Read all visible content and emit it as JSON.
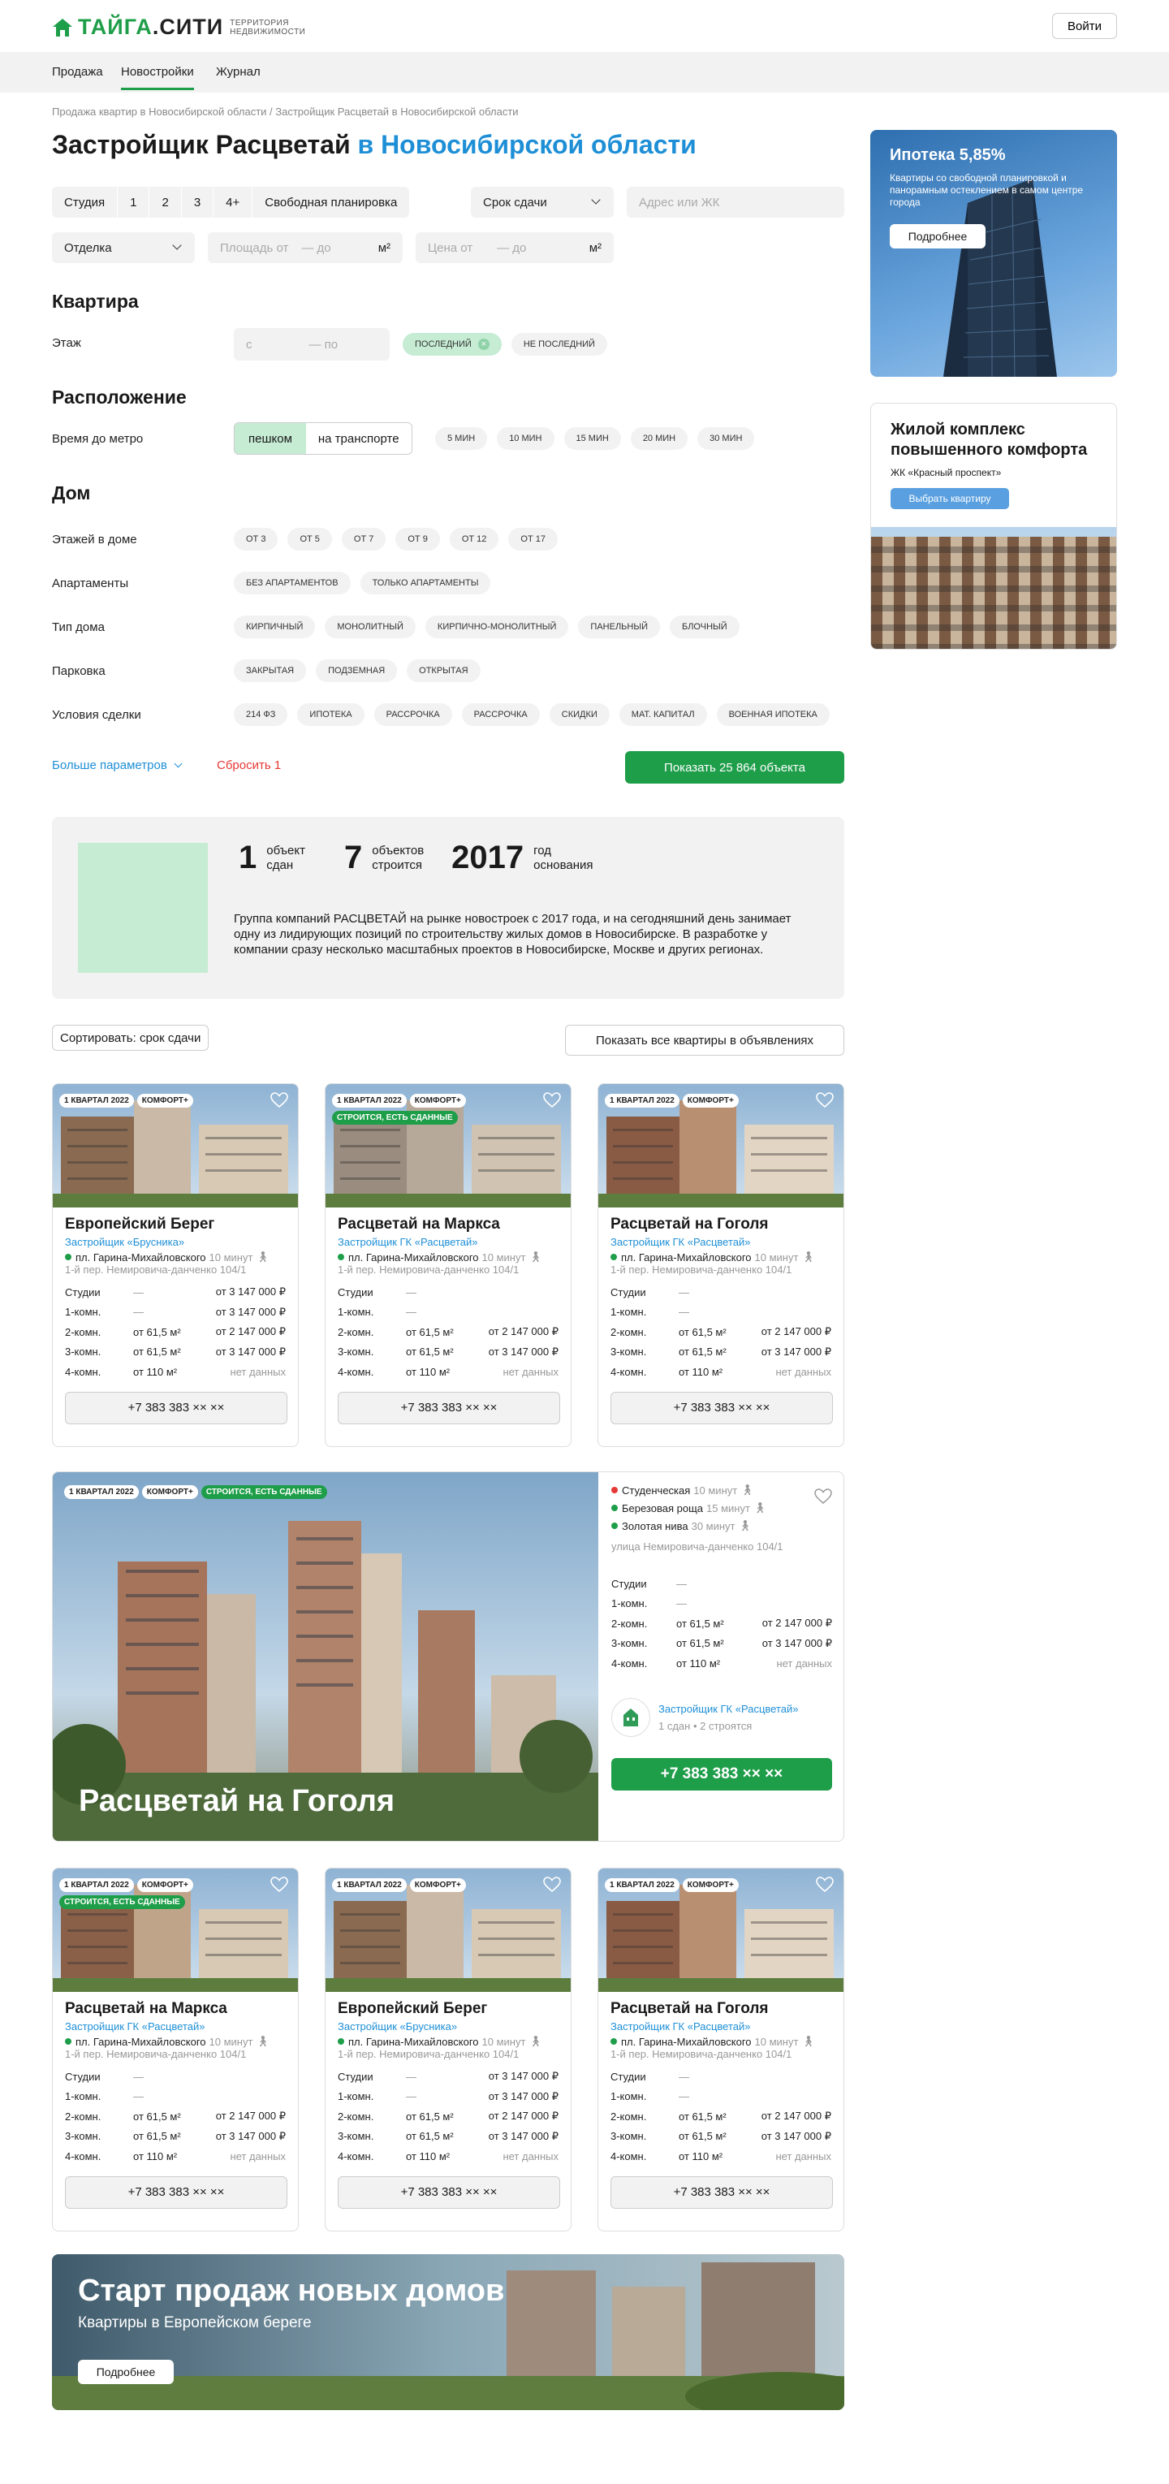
{
  "header": {
    "brand_a": "ТАЙГА",
    "brand_b": ".СИТИ",
    "tagline_1": "ТЕРРИТОРИЯ",
    "tagline_2": "НЕДВИЖИМОСТИ",
    "login": "Войти"
  },
  "nav": [
    "Продажа",
    "Новостройки",
    "Журнал"
  ],
  "breadcrumb": "Продажа квартир в Новосибирской области / Застройщик Расцветай в Новосибирской области",
  "title": {
    "a": "Застройщик Расцветай",
    "b": "в Новосибирской области"
  },
  "filters": {
    "rooms": [
      "Студия",
      "1",
      "2",
      "3",
      "4+",
      "Свободная планировка"
    ],
    "deadline": "Срок сдачи",
    "address_ph": "Адрес или ЖК",
    "finish": "Отделка",
    "area_from": "Площадь от",
    "area_to": "— до",
    "area_unit": "м²",
    "price_from": "Цена от",
    "price_to": "— до",
    "price_unit": "м²"
  },
  "sections": {
    "flat": "Квартира",
    "location": "Расположение",
    "house": "Дом"
  },
  "floor": {
    "label": "Этаж",
    "from": "с",
    "to": "— по",
    "pills": [
      "последний",
      "не последний"
    ]
  },
  "metro": {
    "label": "Время до метро",
    "modes": [
      "пешком",
      "на транспорте"
    ],
    "pills": [
      "5 мин",
      "10 мин",
      "15 мин",
      "20 мин",
      "30 мин"
    ]
  },
  "house_rows": [
    {
      "label": "Этажей в доме",
      "pills": [
        "от 3",
        "от 5",
        "от 7",
        "от 9",
        "от 12",
        "от 17"
      ]
    },
    {
      "label": "Апартаменты",
      "pills": [
        "без апартаментов",
        "только апартаменты"
      ]
    },
    {
      "label": "Тип дома",
      "pills": [
        "кирпичный",
        "монолитный",
        "кирпично-монолитный",
        "панельный",
        "блочный"
      ]
    },
    {
      "label": "Парковка",
      "pills": [
        "закрытая",
        "подземная",
        "открытая"
      ]
    },
    {
      "label": "Условия сделки",
      "pills": [
        "214 ФЗ",
        "ипотека",
        "рассрочка",
        "рассрочка",
        "скидки",
        "мат. капитал",
        "военная ипотека"
      ]
    }
  ],
  "actions": {
    "more": "Больше параметров",
    "reset": "Сбросить 1",
    "show": "Показать 25 864 объекта"
  },
  "stats": [
    {
      "num": "1",
      "l1": "объект",
      "l2": "сдан"
    },
    {
      "num": "7",
      "l1": "объектов",
      "l2": "строится"
    },
    {
      "num": "2017",
      "l1": "год",
      "l2": "основания"
    }
  ],
  "about_text": "Группа компаний РАСЦВЕТАЙ на рынке новостроек с 2017 года, и на сегодняшний день занимает одну из лидирующих позиций по строительству жилых домов в Новосибирске. В разработке у компании сразу несколько масштабных проектов в Новосибирске, Москве и других регионах.",
  "sort": "Сортировать: срок сдачи",
  "show_all": "Показать все квартиры в объявлениях",
  "ads": {
    "mortgage": {
      "title": "Ипотека 5,85%",
      "text": "Квартиры со свободной планировкой и панорамным остеклением в самом центре города",
      "btn": "Подробнее"
    },
    "complex": {
      "title": "Жилой комплекс повышенного комфорта",
      "sub": "ЖК «Красный проспект»",
      "btn": "Выбрать квартиру"
    }
  },
  "cards": [
    {
      "badges": [
        "1 КВАРТАЛ 2022",
        "КОМФОРТ+"
      ],
      "green": "",
      "title": "Европейский Берег",
      "dev": "Застройщик «Брусника»",
      "metro": "пл. Гарина-Михайловского",
      "mins": "10 минут",
      "addr": "1-й пер. Немировича-данченко 104/1",
      "rows": [
        [
          "Студии",
          "—",
          "от 3 147 000 ₽"
        ],
        [
          "1-комн.",
          "—",
          "от 3 147 000 ₽"
        ],
        [
          "2-комн.",
          "от 61,5 м²",
          "от 2 147 000 ₽"
        ],
        [
          "3-комн.",
          "от 61,5 м²",
          "от 3 147 000 ₽"
        ],
        [
          "4-комн.",
          "от 110 м²",
          "нет данных"
        ]
      ],
      "phone": "+7 383 383 ×× ××"
    },
    {
      "badges": [
        "1 КВАРТАЛ 2022",
        "КОМФОРТ+"
      ],
      "green": "СТРОИТСЯ, ЕСТЬ СДАННЫЕ",
      "title": "Расцветай на Марксa",
      "dev": "Застройщик ГК «Расцветай»",
      "metro": "пл. Гарина-Михайловского",
      "mins": "10 минут",
      "addr": "1-й пер. Немировича-данченко 104/1",
      "rows": [
        [
          "Студии",
          "—",
          ""
        ],
        [
          "1-комн.",
          "—",
          ""
        ],
        [
          "2-комн.",
          "от 61,5 м²",
          "от 2 147 000 ₽"
        ],
        [
          "3-комн.",
          "от 61,5 м²",
          "от 3 147 000 ₽"
        ],
        [
          "4-комн.",
          "от 110 м²",
          "нет данных"
        ]
      ],
      "phone": "+7 383 383 ×× ××"
    },
    {
      "badges": [
        "1 КВАРТАЛ 2022",
        "КОМФОРТ+"
      ],
      "green": "",
      "title": "Расцветай на Гоголя",
      "dev": "Застройщик ГК «Расцветай»",
      "metro": "пл. Гарина-Михайловского",
      "mins": "10 минут",
      "addr": "1-й пер. Немировича-данченко 104/1",
      "rows": [
        [
          "Студии",
          "—",
          ""
        ],
        [
          "1-комн.",
          "—",
          ""
        ],
        [
          "2-комн.",
          "от 61,5 м²",
          "от 2 147 000 ₽"
        ],
        [
          "3-комн.",
          "от 61,5 м²",
          "от 3 147 000 ₽"
        ],
        [
          "4-комн.",
          "от 110 м²",
          "нет данных"
        ]
      ],
      "phone": "+7 383 383 ×× ××"
    },
    {
      "badges": [
        "1 КВАРТАЛ 2022",
        "КОМФОРТ+"
      ],
      "green": "СТРОИТСЯ, ЕСТЬ СДАННЫЕ",
      "title": "Расцветай на Марксa",
      "dev": "Застройщик ГК «Расцветай»",
      "metro": "пл. Гарина-Михайловского",
      "mins": "10 минут",
      "addr": "1-й пер. Немировича-данченко 104/1",
      "rows": [
        [
          "Студии",
          "—",
          ""
        ],
        [
          "1-комн.",
          "—",
          ""
        ],
        [
          "2-комн.",
          "от 61,5 м²",
          "от 2 147 000 ₽"
        ],
        [
          "3-комн.",
          "от 61,5 м²",
          "от 3 147 000 ₽"
        ],
        [
          "4-комн.",
          "от 110 м²",
          "нет данных"
        ]
      ],
      "phone": "+7 383 383 ×× ××"
    },
    {
      "badges": [
        "1 КВАРТАЛ 2022",
        "КОМФОРТ+"
      ],
      "green": "",
      "title": "Европейский Берег",
      "dev": "Застройщик «Брусника»",
      "metro": "пл. Гарина-Михайловского",
      "mins": "10 минут",
      "addr": "1-й пер. Немировича-данченко 104/1",
      "rows": [
        [
          "Студии",
          "—",
          "от 3 147 000 ₽"
        ],
        [
          "1-комн.",
          "—",
          "от 3 147 000 ₽"
        ],
        [
          "2-комн.",
          "от 61,5 м²",
          "от 2 147 000 ₽"
        ],
        [
          "3-комн.",
          "от 61,5 м²",
          "от 3 147 000 ₽"
        ],
        [
          "4-комн.",
          "от 110 м²",
          "нет данных"
        ]
      ],
      "phone": "+7 383 383 ×× ××"
    },
    {
      "badges": [
        "1 КВАРТАЛ 2022",
        "КОМФОРТ+"
      ],
      "green": "",
      "title": "Расцветай на Гоголя",
      "dev": "Застройщик ГК «Расцветай»",
      "metro": "пл. Гарина-Михайловского",
      "mins": "10 минут",
      "addr": "1-й пер. Немировича-данченко 104/1",
      "rows": [
        [
          "Студии",
          "—",
          ""
        ],
        [
          "1-комн.",
          "—",
          ""
        ],
        [
          "2-комн.",
          "от 61,5 м²",
          "от 2 147 000 ₽"
        ],
        [
          "3-комн.",
          "от 61,5 м²",
          "от 3 147 000 ₽"
        ],
        [
          "4-комн.",
          "от 110 м²",
          "нет данных"
        ]
      ],
      "phone": "+7 383 383 ×× ××"
    }
  ],
  "big": {
    "badges": [
      "1 КВАРТАЛ 2022",
      "КОМФОРТ+"
    ],
    "green": "СТРОИТСЯ, ЕСТЬ СДАННЫЕ",
    "title": "Расцветай на Гоголя",
    "metros": [
      {
        "name": "Студенческая",
        "mins": "10 минут",
        "color": "#e53935"
      },
      {
        "name": "Березовая роща",
        "mins": "15 минут",
        "color": "#1f9e4a"
      },
      {
        "name": "Золотая нива",
        "mins": "30 минут",
        "color": "#1f9e4a"
      }
    ],
    "addr": "улица Немировича-данченко 104/1",
    "rows": [
      [
        "Студии",
        "—",
        ""
      ],
      [
        "1-комн.",
        "—",
        ""
      ],
      [
        "2-комн.",
        "от 61,5 м²",
        "от 2 147 000 ₽"
      ],
      [
        "3-комн.",
        "от 61,5 м²",
        "от 3 147 000 ₽"
      ],
      [
        "4-комн.",
        "от 110 м²",
        "нет данных"
      ]
    ],
    "dev": "Застройщик ГК «Расцветай»",
    "dev_sub": "1 сдан • 2 строятся",
    "phone": "+7 383 383 ×× ××"
  },
  "promo": {
    "title": "Старт продаж новых домов",
    "sub": "Квартиры в Европейском береге",
    "btn": "Подробнее"
  },
  "colors": {
    "brand": "#1f9e4a",
    "link": "#1e8fd6",
    "reset": "#e53935"
  }
}
